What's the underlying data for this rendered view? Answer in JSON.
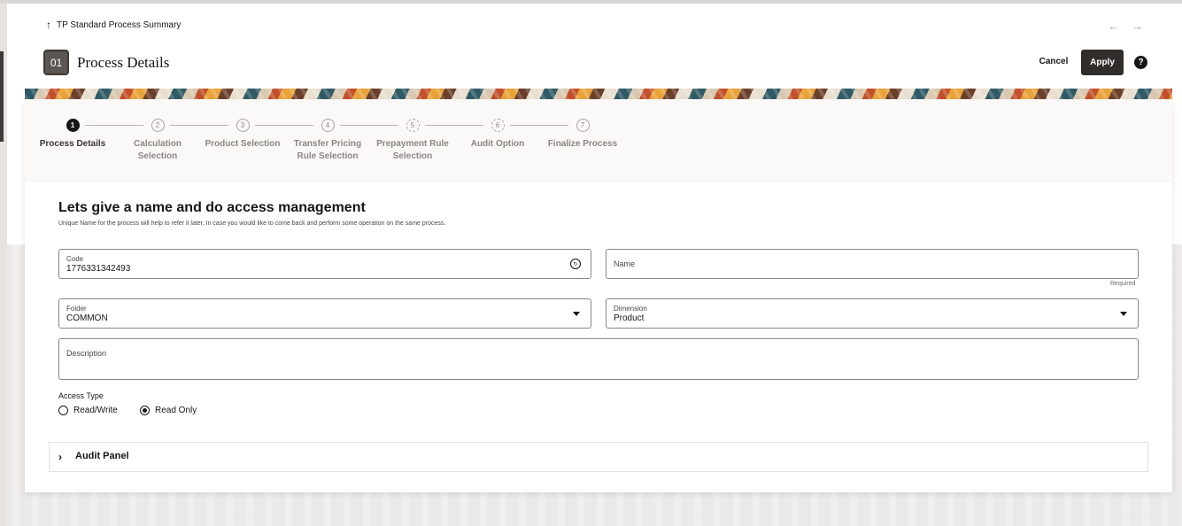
{
  "header": {
    "back_label": "TP Standard Process Summary",
    "badge": "01",
    "title": "Process Details",
    "cancel_label": "Cancel",
    "apply_label": "Apply",
    "help_glyph": "?"
  },
  "train": {
    "steps": [
      {
        "number": "1",
        "label_line1": "Process Details",
        "label_line2": ""
      },
      {
        "number": "2",
        "label_line1": "Calculation",
        "label_line2": "Selection"
      },
      {
        "number": "3",
        "label_line1": "Product Selection",
        "label_line2": ""
      },
      {
        "number": "4",
        "label_line1": "Transfer Pricing",
        "label_line2": "Rule Selection"
      },
      {
        "number": "5",
        "label_line1": "Prepayment Rule",
        "label_line2": "Selection"
      },
      {
        "number": "6",
        "label_line1": "Audit Option",
        "label_line2": ""
      },
      {
        "number": "7",
        "label_line1": "Finalize Process",
        "label_line2": ""
      }
    ]
  },
  "form": {
    "title": "Lets give a name and do access management",
    "subtitle": "Unique Name for the process will help to refer it later, In case you would like to come back and perform some operation on the same process.",
    "code_label": "Code",
    "code_value": "1776331342493",
    "name_label": "Name",
    "required_text": "Required",
    "folder_label": "Folder",
    "folder_value": "COMMON",
    "dimension_label": "Dimension",
    "dimension_value": "Product",
    "description_label": "Description",
    "access_type_label": "Access Type",
    "access_options": [
      "Read/Write",
      "Read Only"
    ],
    "access_selected": "Read Only"
  },
  "audit_panel": {
    "title": "Audit Panel"
  },
  "colors": {
    "primary_button": "#312d2a",
    "text": "#161513",
    "muted": "#8b8580"
  }
}
